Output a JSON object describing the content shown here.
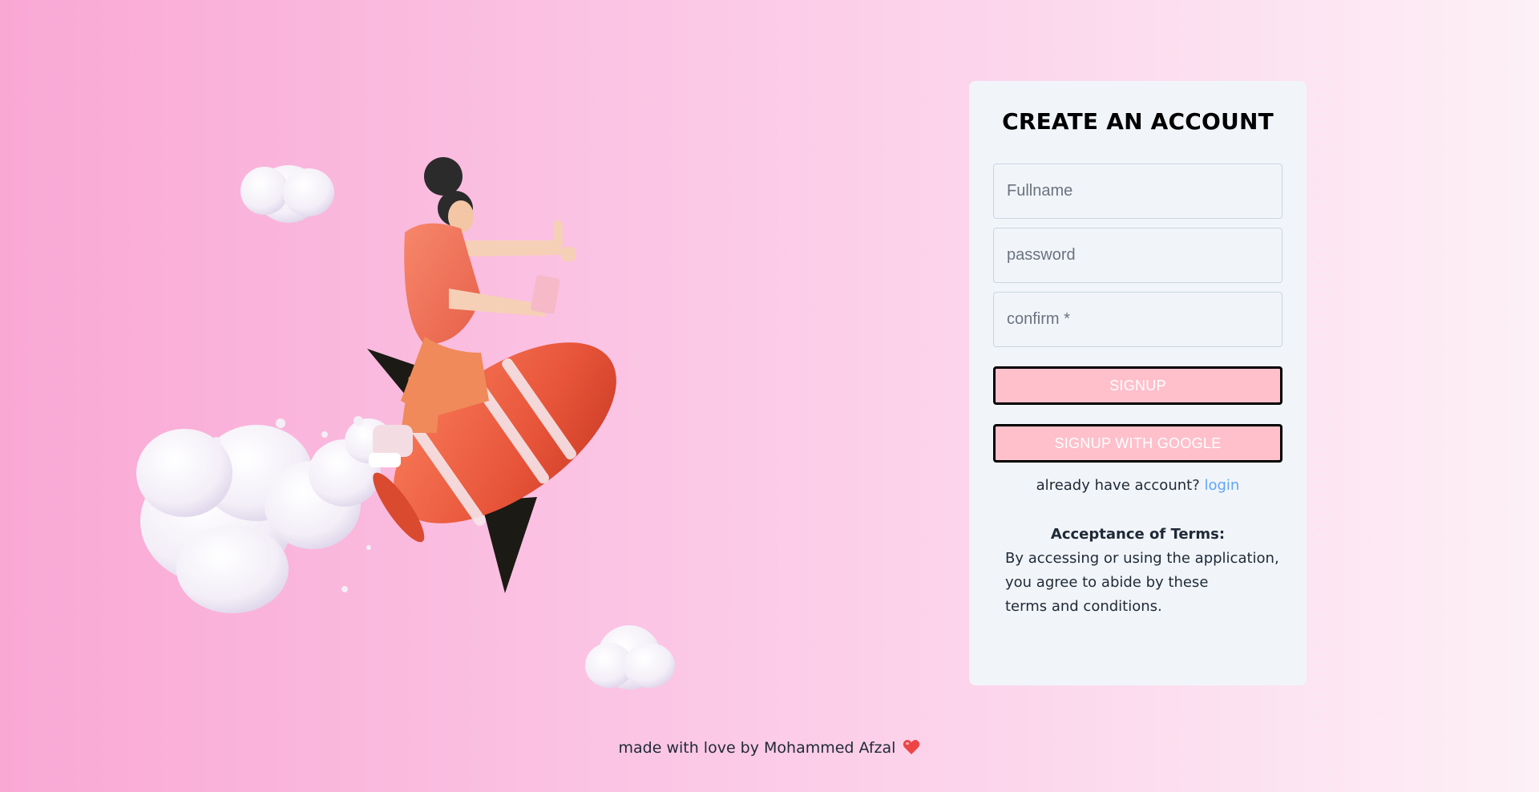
{
  "signup": {
    "title": "CREATE AN ACCOUNT",
    "fullname_placeholder": "Fullname",
    "password_placeholder": "password",
    "confirm_placeholder": "confirm *",
    "signup_button": "SIGNUP",
    "google_button": "SIGNUP WITH GOOGLE",
    "login_prompt": "already have account?",
    "login_link": "login"
  },
  "terms": {
    "title": "Acceptance of Terms:",
    "line1": "By accessing or using the application,",
    "line2": "you agree to abide by these",
    "line3": "terms and conditions."
  },
  "footer": {
    "text": "made with love by Mohammed Afzal"
  },
  "colors": {
    "button_bg": "#ffc0cb",
    "link": "#60a5fa",
    "card_bg": "#f1f5f9"
  },
  "icons": {
    "footer": "heart-icon",
    "illustration": "rocket-rider-illustration"
  }
}
